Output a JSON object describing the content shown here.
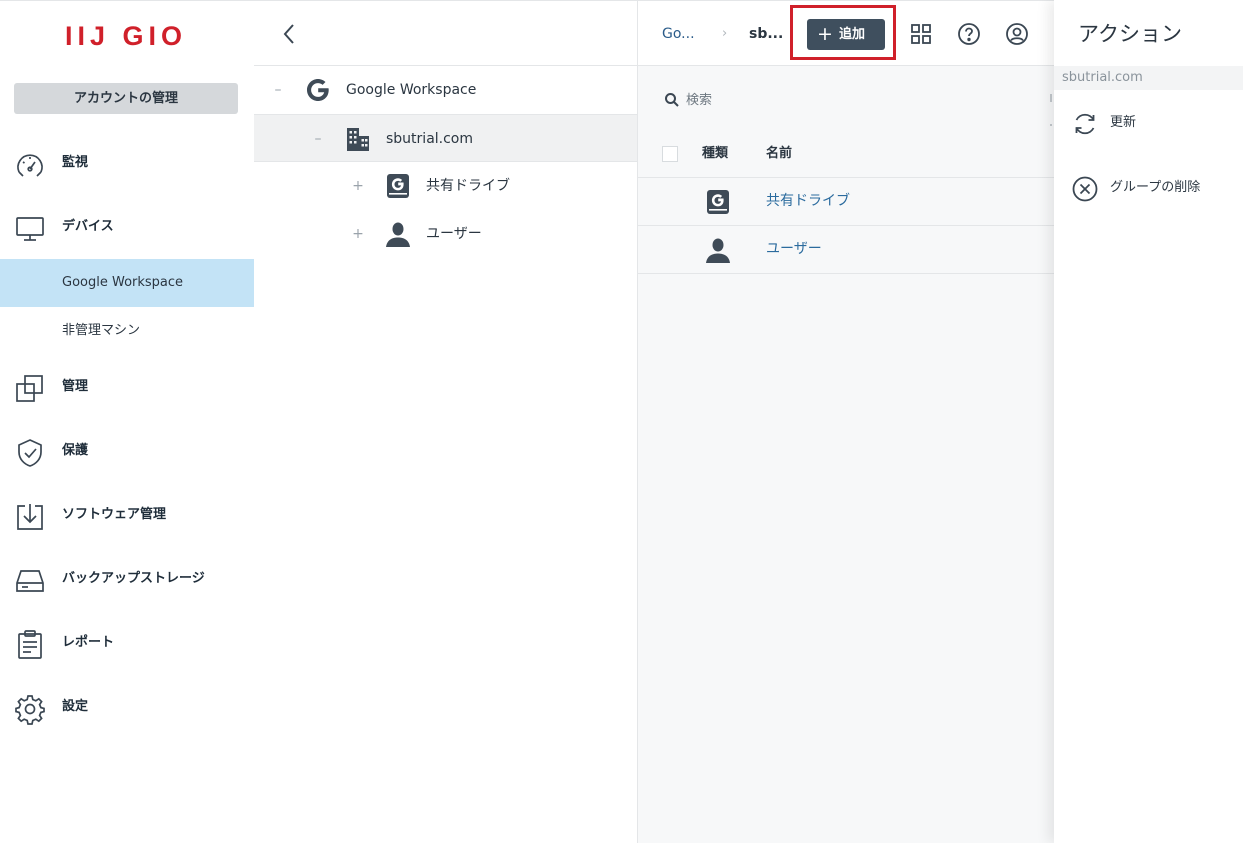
{
  "brand": {
    "logo_text": "IIJ GIO",
    "logo_color": "#d0202a"
  },
  "sidebar": {
    "account_button": "アカウントの管理",
    "items": [
      {
        "label": "監視",
        "icon": "gauge-icon"
      },
      {
        "label": "デバイス",
        "icon": "monitor-icon"
      },
      {
        "label": "管理",
        "icon": "copy-squares-icon"
      },
      {
        "label": "保護",
        "icon": "shield-check-icon"
      },
      {
        "label": "ソフトウェア管理",
        "icon": "download-box-icon"
      },
      {
        "label": "バックアップストレージ",
        "icon": "hard-drive-icon"
      },
      {
        "label": "レポート",
        "icon": "clipboard-icon"
      },
      {
        "label": "設定",
        "icon": "gear-icon"
      }
    ],
    "sub_items": [
      {
        "label": "Google Workspace",
        "active": true
      },
      {
        "label": "非管理マシン",
        "active": false
      }
    ],
    "active_color": "#c3e3f6"
  },
  "tree": {
    "rows": [
      {
        "toggle": "–",
        "label": "Google Workspace",
        "icon": "google-g-icon"
      },
      {
        "toggle": "–",
        "label": "sbutrial.com",
        "icon": "building-icon"
      },
      {
        "toggle": "+",
        "label": "共有ドライブ",
        "icon": "shared-drive-icon"
      },
      {
        "toggle": "+",
        "label": "ユーザー",
        "icon": "user-icon"
      }
    ]
  },
  "main": {
    "breadcrumb": [
      "Go...",
      "sb..."
    ],
    "breadcrumb_separator": "›",
    "add_button": {
      "plus": "+",
      "label": "追加"
    },
    "highlight_color": "#d0202a",
    "search_placeholder": "検索",
    "table": {
      "headers": [
        "種類",
        "名前"
      ],
      "rows": [
        {
          "type_icon": "shared-drive-icon",
          "name": "共有ドライブ"
        },
        {
          "type_icon": "user-icon",
          "name": "ユーザー"
        }
      ]
    }
  },
  "action_panel": {
    "title": "アクション",
    "subtitle": "sbutrial.com",
    "items": [
      {
        "label": "更新",
        "icon": "refresh-icon"
      },
      {
        "label": "グループの削除",
        "icon": "circle-x-icon"
      }
    ]
  }
}
